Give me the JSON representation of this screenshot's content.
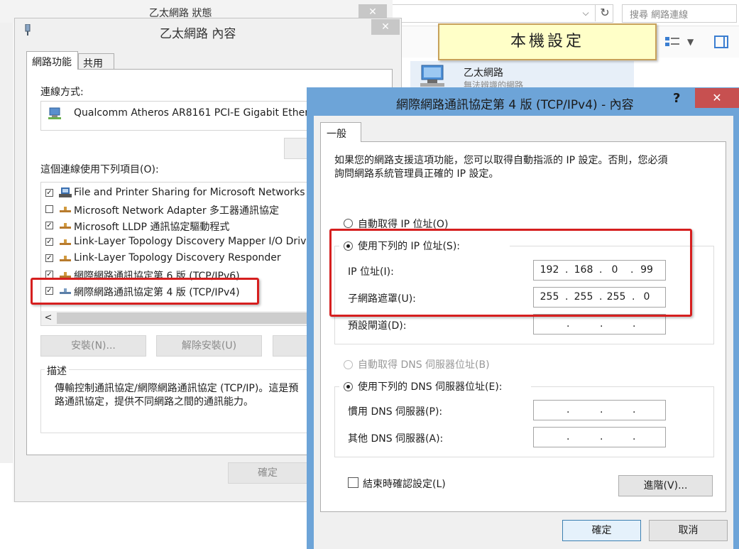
{
  "background_windows": {
    "status_title": "乙太網路 狀態",
    "search_placeholder": "搜尋 網路連線",
    "ethernet_item": {
      "name": "乙太網路",
      "status": "無法辨識的網路"
    }
  },
  "annotation": {
    "note": "本機設定"
  },
  "props_dialog": {
    "title": "乙太網路 內容",
    "tabs": [
      "網路功能",
      "共用"
    ],
    "connect_using_label": "連線方式:",
    "adapter": "Qualcomm Atheros AR8161 PCI-E Gigabit Ether",
    "items_label": "這個連線使用下列項目(O):",
    "items": [
      {
        "label": "File and Printer Sharing for Microsoft Networks",
        "checked": true,
        "icon": "printer-share-icon"
      },
      {
        "label": "Microsoft Network Adapter 多工器通訊協定",
        "checked": false,
        "icon": "protocol-icon"
      },
      {
        "label": "Microsoft LLDP 通訊協定驅動程式",
        "checked": true,
        "icon": "protocol-icon"
      },
      {
        "label": "Link-Layer Topology Discovery Mapper I/O Driv",
        "checked": true,
        "icon": "protocol-icon"
      },
      {
        "label": "Link-Layer Topology Discovery Responder",
        "checked": true,
        "icon": "protocol-icon"
      },
      {
        "label": "網際網路通訊協定第 6 版 (TCP/IPv6)",
        "checked": true,
        "icon": "protocol-icon"
      },
      {
        "label": "網際網路通訊協定第 4 版 (TCP/IPv4)",
        "checked": true,
        "icon": "protocol-icon",
        "selected": true
      }
    ],
    "scroll_left": "<",
    "install_button": "安裝(N)...",
    "uninstall_button": "解除安裝(U)",
    "description_label": "描述",
    "description_text": "傳輸控制通訊協定/網際網路通訊協定 (TCP/IP)。這是預設的廣域網路通訊協定，提供不同網路之間的通訊能力。",
    "description_line1": "傳輸控制通訊協定/網際網路通訊協定 (TCP/IP)。這是預",
    "description_line2": "路通訊協定，提供不同網路之間的通訊能力。",
    "ok_button": "確定"
  },
  "ipv4_dialog": {
    "title": "網際網路通訊協定第 4 版 (TCP/IPv4) - 內容",
    "help": "?",
    "close": "✕",
    "tab": "一般",
    "intro_line1": "如果您的網路支援這項功能，您可以取得自動指派的 IP 設定。否則，您必須",
    "intro_line2": "詢問網路系統管理員正確的 IP 設定。",
    "ip_auto_label": "自動取得 IP 位址(O)",
    "ip_manual_label": "使用下列的 IP 位址(S):",
    "ip_mode": "manual",
    "ip_address_label": "IP 位址(I):",
    "ip_address": [
      "192",
      "168",
      "0",
      "99"
    ],
    "subnet_label": "子網路遮罩(U):",
    "subnet_mask": [
      "255",
      "255",
      "255",
      "0"
    ],
    "gateway_label": "預設閘道(D):",
    "gateway": [
      "",
      "",
      "",
      ""
    ],
    "dns_auto_label": "自動取得 DNS 伺服器位址(B)",
    "dns_manual_label": "使用下列的 DNS 伺服器位址(E):",
    "dns_mode": "manual",
    "preferred_dns_label": "慣用 DNS 伺服器(P):",
    "preferred_dns": [
      "",
      "",
      "",
      ""
    ],
    "alternate_dns_label": "其他 DNS 伺服器(A):",
    "alternate_dns": [
      "",
      "",
      "",
      ""
    ],
    "validate_on_exit_label": "結束時確認設定(L)",
    "validate_on_exit": false,
    "advanced_button": "進階(V)...",
    "ok_button": "確定",
    "cancel_button": "取消"
  },
  "colors": {
    "accent_titlebar": "#6da4d8",
    "close_red": "#c75050",
    "highlight_red": "#d61f1f",
    "note_bg": "#ffffc8"
  }
}
